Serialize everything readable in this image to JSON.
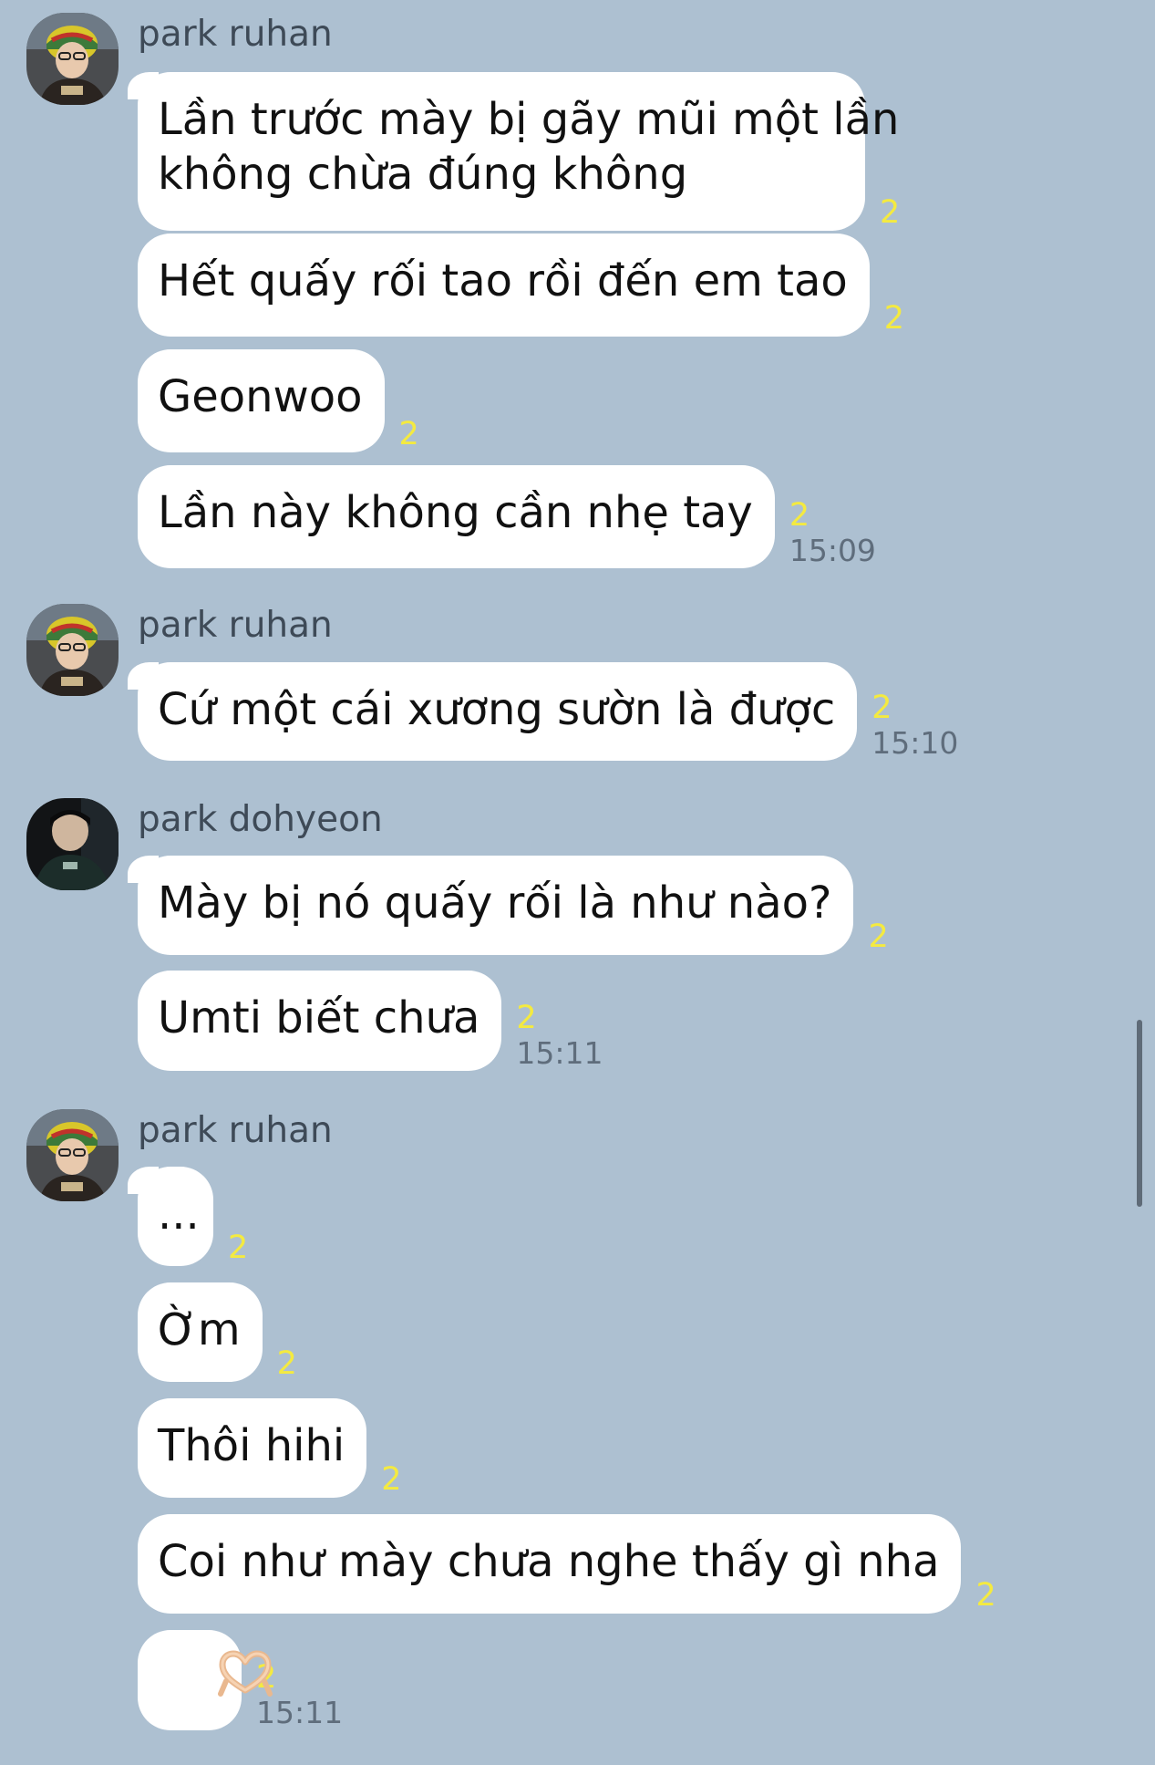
{
  "colors": {
    "chat_background": "#adc0d1",
    "bubble": "#ffffff",
    "unread_count": "#f4ea40",
    "timestamp": "#5f6d7c",
    "sender_name": "#3e4a57"
  },
  "groups": [
    {
      "sender": "park ruhan",
      "avatar": "avatar-photo",
      "messages": [
        {
          "text": "Lần trước mày bị gãy mũi một lần\nkhông chừa đúng không",
          "unread": "2",
          "time": ""
        },
        {
          "text": "Hết quấy rối tao rồi đến em tao",
          "unread": "2",
          "time": ""
        },
        {
          "text": "Geonwoo",
          "unread": "2",
          "time": ""
        },
        {
          "text": "Lần này không cần nhẹ tay",
          "unread": "2",
          "time": "15:09"
        }
      ]
    },
    {
      "sender": "park ruhan",
      "avatar": "avatar-photo",
      "messages": [
        {
          "text": "Cứ một cái xương sườn là được",
          "unread": "2",
          "time": "15:10"
        }
      ]
    },
    {
      "sender": "park dohyeon",
      "avatar": "avatar-photo",
      "messages": [
        {
          "text": "Mày bị nó quấy rối là như nào?",
          "unread": "2",
          "time": ""
        },
        {
          "text": "Umti biết chưa",
          "unread": "2",
          "time": "15:11"
        }
      ]
    },
    {
      "sender": "park ruhan",
      "avatar": "avatar-photo",
      "messages": [
        {
          "text": "...",
          "unread": "2",
          "time": ""
        },
        {
          "text": "Ờm",
          "unread": "2",
          "time": ""
        },
        {
          "text": "Thôi hihi",
          "unread": "2",
          "time": ""
        },
        {
          "text": "Coi như mày chưa nghe thấy gì nha",
          "unread": "2",
          "time": ""
        },
        {
          "text": "🫶",
          "emoji_icon": "heart-hands-icon",
          "unread": "2",
          "time": "15:11"
        }
      ]
    }
  ]
}
